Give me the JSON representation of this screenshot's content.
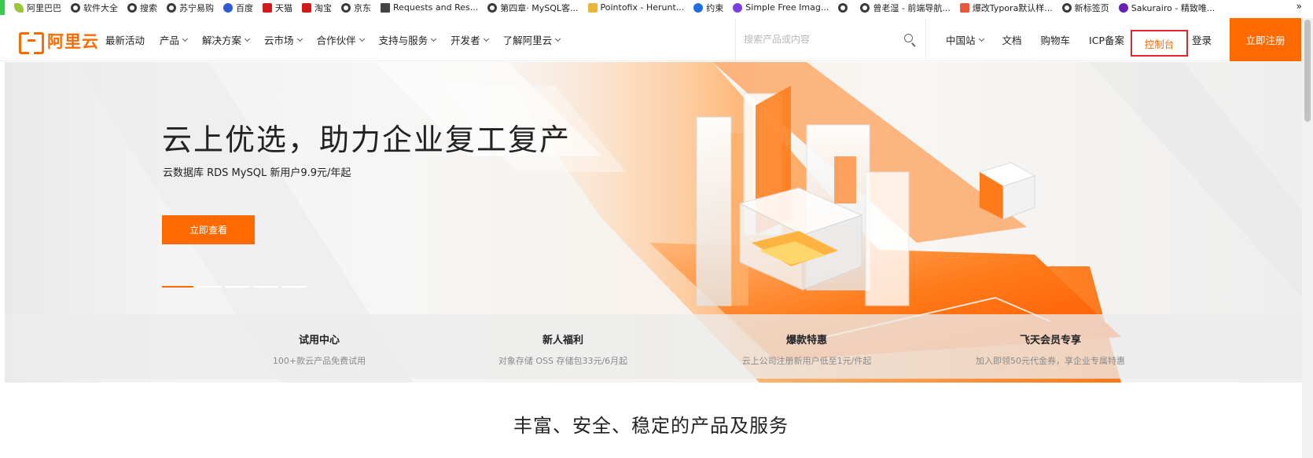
{
  "bookmarks": {
    "items": [
      {
        "label": "阿里巴巴",
        "icon": "leaf-icon"
      },
      {
        "label": "软件大全",
        "icon": "globe-icon"
      },
      {
        "label": "搜索",
        "icon": "globe-icon"
      },
      {
        "label": "苏宁易购",
        "icon": "globe-icon"
      },
      {
        "label": "百度",
        "icon": "paw-icon"
      },
      {
        "label": "天猫",
        "icon": "tmall-icon"
      },
      {
        "label": "淘宝",
        "icon": "taobao-icon"
      },
      {
        "label": "京东",
        "icon": "globe-icon"
      },
      {
        "label": "Requests and Res...",
        "icon": "book-icon"
      },
      {
        "label": "第四章· MySQL客...",
        "icon": "globe-icon"
      },
      {
        "label": "Pointofix - Herunt...",
        "icon": "pointofix-icon"
      },
      {
        "label": "约束",
        "icon": "c-icon"
      },
      {
        "label": "Simple Free Imag...",
        "icon": "s-icon"
      },
      {
        "label": "",
        "icon": "globe-icon"
      },
      {
        "label": "曾老湿 - 前端导航...",
        "icon": "globe-icon"
      },
      {
        "label": "爆改Typora默认样...",
        "icon": "red-icon"
      },
      {
        "label": "新标签页",
        "icon": "globe-icon"
      },
      {
        "label": "Sakurairo - 精致唯...",
        "icon": "n-icon"
      }
    ],
    "more": "»"
  },
  "nav": {
    "logo": "阿里云",
    "menu": [
      {
        "label": "最新活动",
        "caret": false
      },
      {
        "label": "产品",
        "caret": true
      },
      {
        "label": "解决方案",
        "caret": true
      },
      {
        "label": "云市场",
        "caret": true
      },
      {
        "label": "合作伙伴",
        "caret": true
      },
      {
        "label": "支持与服务",
        "caret": true
      },
      {
        "label": "开发者",
        "caret": true
      },
      {
        "label": "了解阿里云",
        "caret": true
      }
    ],
    "search_placeholder": "搜索产品或内容",
    "search_value": "",
    "right": [
      {
        "label": "中国站",
        "caret": true
      },
      {
        "label": "文档",
        "caret": false
      },
      {
        "label": "购物车",
        "caret": false
      },
      {
        "label": "ICP备案",
        "caret": false
      }
    ],
    "console": "控制台",
    "login": "登录",
    "register": "立即注册"
  },
  "hero": {
    "title": "云上优选，助力企业复工复产",
    "subtitle": "云数据库 RDS MySQL 新用户9.9元/年起",
    "button": "立即查看",
    "slides_total": 5,
    "active_slide": 1
  },
  "features": [
    {
      "title": "试用中心",
      "desc": "100+款云产品免费试用"
    },
    {
      "title": "新人福利",
      "desc": "对象存储 OSS 存储包33元/6月起"
    },
    {
      "title": "爆款特惠",
      "desc": "云上公司注册新用户低至1元/件起"
    },
    {
      "title": "飞天会员专享",
      "desc": "加入即领50元代金券，享企业专属特惠"
    }
  ],
  "section_title": "丰富、安全、稳定的产品及服务",
  "colors": {
    "accent": "#ff6a00",
    "highlight_border": "#e0262d"
  }
}
